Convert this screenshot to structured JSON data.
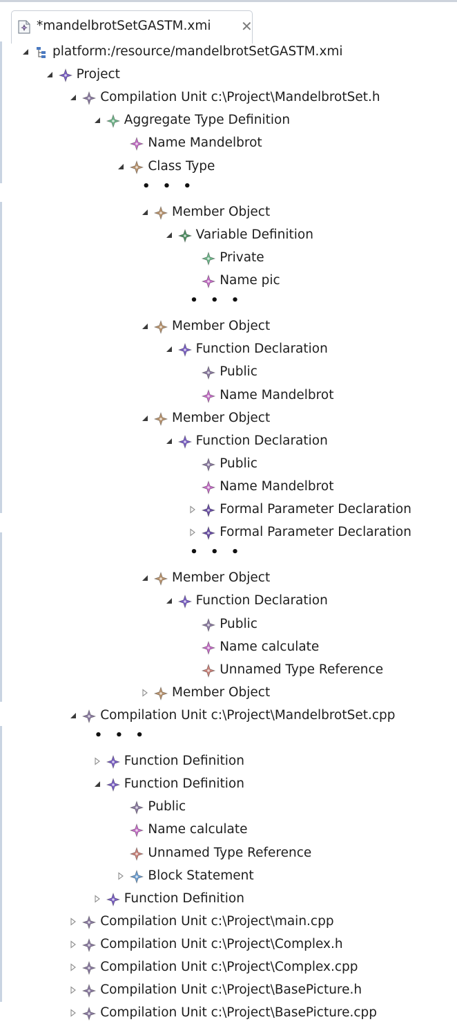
{
  "tab": {
    "title": "*mandelbrotSetGASTM.xmi",
    "icon": "xmi-file-icon",
    "close_icon": "close-icon"
  },
  "colors": {
    "violet": "#7a5fc4",
    "gray": "#8a7aa0",
    "green": "#6fb58a",
    "tan": "#b9946f",
    "pink": "#c46ec6",
    "darkgreen": "#4f8f63",
    "salmon": "#c9827a",
    "blue": "#6c9ed0",
    "dark": "#6a4fa6"
  },
  "ellipsis": "• • •",
  "tree": [
    {
      "label": "platform:/resource/mandelbrotSetGASTM.xmi",
      "depth": 0,
      "state": "expanded",
      "icon": "resource-tree-icon"
    },
    {
      "label": "Project",
      "depth": 1,
      "state": "expanded",
      "color": "violet"
    },
    {
      "label": "Compilation Unit c:\\Project\\MandelbrotSet.h",
      "depth": 2,
      "state": "expanded",
      "color": "gray"
    },
    {
      "label": "Aggregate Type Definition",
      "depth": 3,
      "state": "expanded",
      "color": "green"
    },
    {
      "label": "Name Mandelbrot",
      "depth": 4,
      "state": "leaf",
      "color": "pink"
    },
    {
      "label": "Class Type",
      "depth": 4,
      "state": "expanded",
      "color": "tan"
    },
    {
      "ellipsis": true,
      "depth": 5
    },
    {
      "label": "Member Object",
      "depth": 5,
      "state": "expanded",
      "color": "tan"
    },
    {
      "label": "Variable Definition",
      "depth": 6,
      "state": "expanded",
      "color": "darkgreen"
    },
    {
      "label": "Private",
      "depth": 7,
      "state": "leaf",
      "color": "green"
    },
    {
      "label": "Name pic",
      "depth": 7,
      "state": "leaf",
      "color": "pink"
    },
    {
      "ellipsis": true,
      "depth": 7
    },
    {
      "label": "Member Object",
      "depth": 5,
      "state": "expanded",
      "color": "tan"
    },
    {
      "label": "Function Declaration",
      "depth": 6,
      "state": "expanded",
      "color": "violet"
    },
    {
      "label": "Public",
      "depth": 7,
      "state": "leaf",
      "color": "gray"
    },
    {
      "label": "Name Mandelbrot",
      "depth": 7,
      "state": "leaf",
      "color": "pink"
    },
    {
      "label": "Member Object",
      "depth": 5,
      "state": "expanded",
      "color": "tan"
    },
    {
      "label": "Function Declaration",
      "depth": 6,
      "state": "expanded",
      "color": "violet"
    },
    {
      "label": "Public",
      "depth": 7,
      "state": "leaf",
      "color": "gray"
    },
    {
      "label": "Name Mandelbrot",
      "depth": 7,
      "state": "leaf",
      "color": "pink"
    },
    {
      "label": "Formal Parameter Declaration",
      "depth": 7,
      "state": "collapsed",
      "color": "dark"
    },
    {
      "label": "Formal Parameter Declaration",
      "depth": 7,
      "state": "collapsed",
      "color": "dark"
    },
    {
      "ellipsis": true,
      "depth": 7
    },
    {
      "label": "Member Object",
      "depth": 5,
      "state": "expanded",
      "color": "tan"
    },
    {
      "label": "Function Declaration",
      "depth": 6,
      "state": "expanded",
      "color": "violet"
    },
    {
      "label": "Public",
      "depth": 7,
      "state": "leaf",
      "color": "gray"
    },
    {
      "label": "Name calculate",
      "depth": 7,
      "state": "leaf",
      "color": "pink"
    },
    {
      "label": "Unnamed Type Reference",
      "depth": 7,
      "state": "leaf",
      "color": "salmon"
    },
    {
      "label": "Member Object",
      "depth": 5,
      "state": "collapsed",
      "color": "tan"
    },
    {
      "label": "Compilation Unit c:\\Project\\MandelbrotSet.cpp",
      "depth": 2,
      "state": "expanded",
      "color": "gray"
    },
    {
      "ellipsis": true,
      "depth": 3
    },
    {
      "label": "Function Definition",
      "depth": 3,
      "state": "collapsed",
      "color": "violet"
    },
    {
      "label": "Function Definition",
      "depth": 3,
      "state": "expanded",
      "color": "violet"
    },
    {
      "label": "Public",
      "depth": 4,
      "state": "leaf",
      "color": "gray"
    },
    {
      "label": "Name calculate",
      "depth": 4,
      "state": "leaf",
      "color": "pink"
    },
    {
      "label": "Unnamed Type Reference",
      "depth": 4,
      "state": "leaf",
      "color": "salmon"
    },
    {
      "label": "Block Statement",
      "depth": 4,
      "state": "collapsed",
      "color": "blue"
    },
    {
      "label": "Function Definition",
      "depth": 3,
      "state": "collapsed",
      "color": "violet"
    },
    {
      "label": "Compilation Unit c:\\Project\\main.cpp",
      "depth": 2,
      "state": "collapsed",
      "color": "gray"
    },
    {
      "label": "Compilation Unit c:\\Project\\Complex.h",
      "depth": 2,
      "state": "collapsed",
      "color": "gray"
    },
    {
      "label": "Compilation Unit c:\\Project\\Complex.cpp",
      "depth": 2,
      "state": "collapsed",
      "color": "gray"
    },
    {
      "label": "Compilation Unit c:\\Project\\BasePicture.h",
      "depth": 2,
      "state": "collapsed",
      "color": "gray"
    },
    {
      "label": "Compilation Unit c:\\Project\\BasePicture.cpp",
      "depth": 2,
      "state": "collapsed",
      "color": "gray"
    }
  ]
}
